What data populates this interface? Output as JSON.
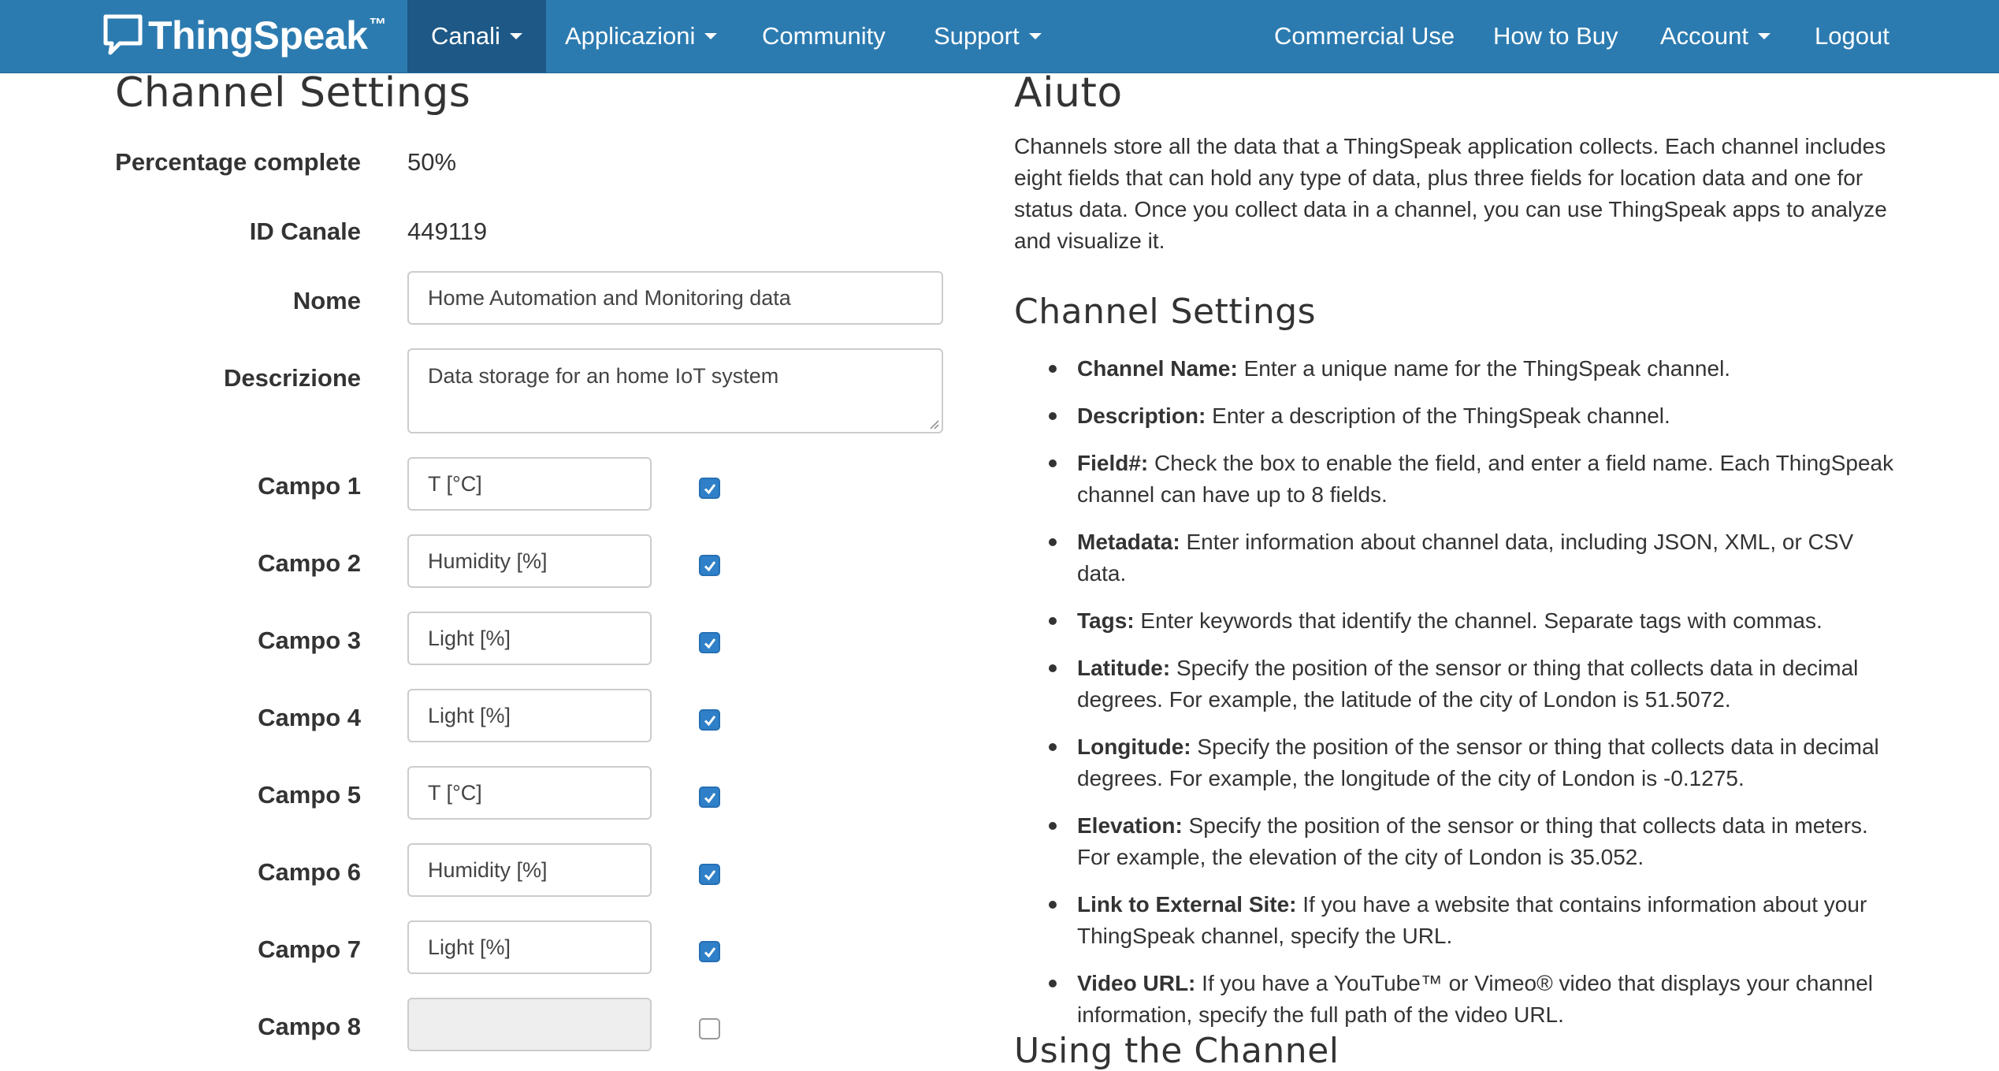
{
  "navbar": {
    "brand": "ThingSpeak",
    "brand_tm": "™",
    "items": [
      {
        "label": "Canali",
        "dropdown": true
      },
      {
        "label": "Applicazioni",
        "dropdown": true
      },
      {
        "label": "Community",
        "dropdown": false
      },
      {
        "label": "Support",
        "dropdown": true
      },
      {
        "label": "Commercial Use",
        "dropdown": false
      },
      {
        "label": "How to Buy",
        "dropdown": false
      },
      {
        "label": "Account",
        "dropdown": true
      },
      {
        "label": "Logout",
        "dropdown": false
      }
    ]
  },
  "form": {
    "title": "Channel Settings",
    "percentage_label": "Percentage complete",
    "percentage_value": "50%",
    "id_label": "ID Canale",
    "id_value": "449119",
    "name_label": "Nome",
    "name_value": "Home Automation and Monitoring data",
    "description_label": "Descrizione",
    "description_value": "Data storage for an home IoT system",
    "fields": [
      {
        "label": "Campo 1",
        "value": "T [°C]",
        "enabled": true
      },
      {
        "label": "Campo 2",
        "value": "Humidity [%]",
        "enabled": true
      },
      {
        "label": "Campo 3",
        "value": "Light [%]",
        "enabled": true
      },
      {
        "label": "Campo 4",
        "value": "Light [%]",
        "enabled": true
      },
      {
        "label": "Campo 5",
        "value": "T [°C]",
        "enabled": true
      },
      {
        "label": "Campo 6",
        "value": "Humidity [%]",
        "enabled": true
      },
      {
        "label": "Campo 7",
        "value": "Light [%]",
        "enabled": true
      },
      {
        "label": "Campo 8",
        "value": "",
        "enabled": false
      }
    ]
  },
  "help": {
    "title": "Aiuto",
    "intro": "Channels store all the data that a ThingSpeak application collects. Each channel includes eight fields that can hold any type of data, plus three fields for location data and one for status data. Once you collect data in a channel, you can use ThingSpeak apps to analyze and visualize it.",
    "settings_title": "Channel Settings",
    "items": [
      {
        "term": "Channel Name:",
        "text": " Enter a unique name for the ThingSpeak channel."
      },
      {
        "term": "Description:",
        "text": " Enter a description of the ThingSpeak channel."
      },
      {
        "term": "Field#:",
        "text": " Check the box to enable the field, and enter a field name. Each ThingSpeak channel can have up to 8 fields."
      },
      {
        "term": "Metadata:",
        "text": " Enter information about channel data, including JSON, XML, or CSV data."
      },
      {
        "term": "Tags:",
        "text": " Enter keywords that identify the channel. Separate tags with commas."
      },
      {
        "term": "Latitude:",
        "text": " Specify the position of the sensor or thing that collects data in decimal degrees. For example, the latitude of the city of London is 51.5072."
      },
      {
        "term": "Longitude:",
        "text": " Specify the position of the sensor or thing that collects data in decimal degrees. For example, the longitude of the city of London is -0.1275."
      },
      {
        "term": "Elevation:",
        "text": " Specify the position of the sensor or thing that collects data in meters. For example, the elevation of the city of London is 35.052."
      },
      {
        "term": "Link to External Site:",
        "text": " If you have a website that contains information about your ThingSpeak channel, specify the URL."
      },
      {
        "term": "Video URL:",
        "text": " If you have a YouTube™ or Vimeo® video that displays your channel information, specify the full path of the video URL."
      }
    ],
    "using_title": "Using the Channel"
  }
}
